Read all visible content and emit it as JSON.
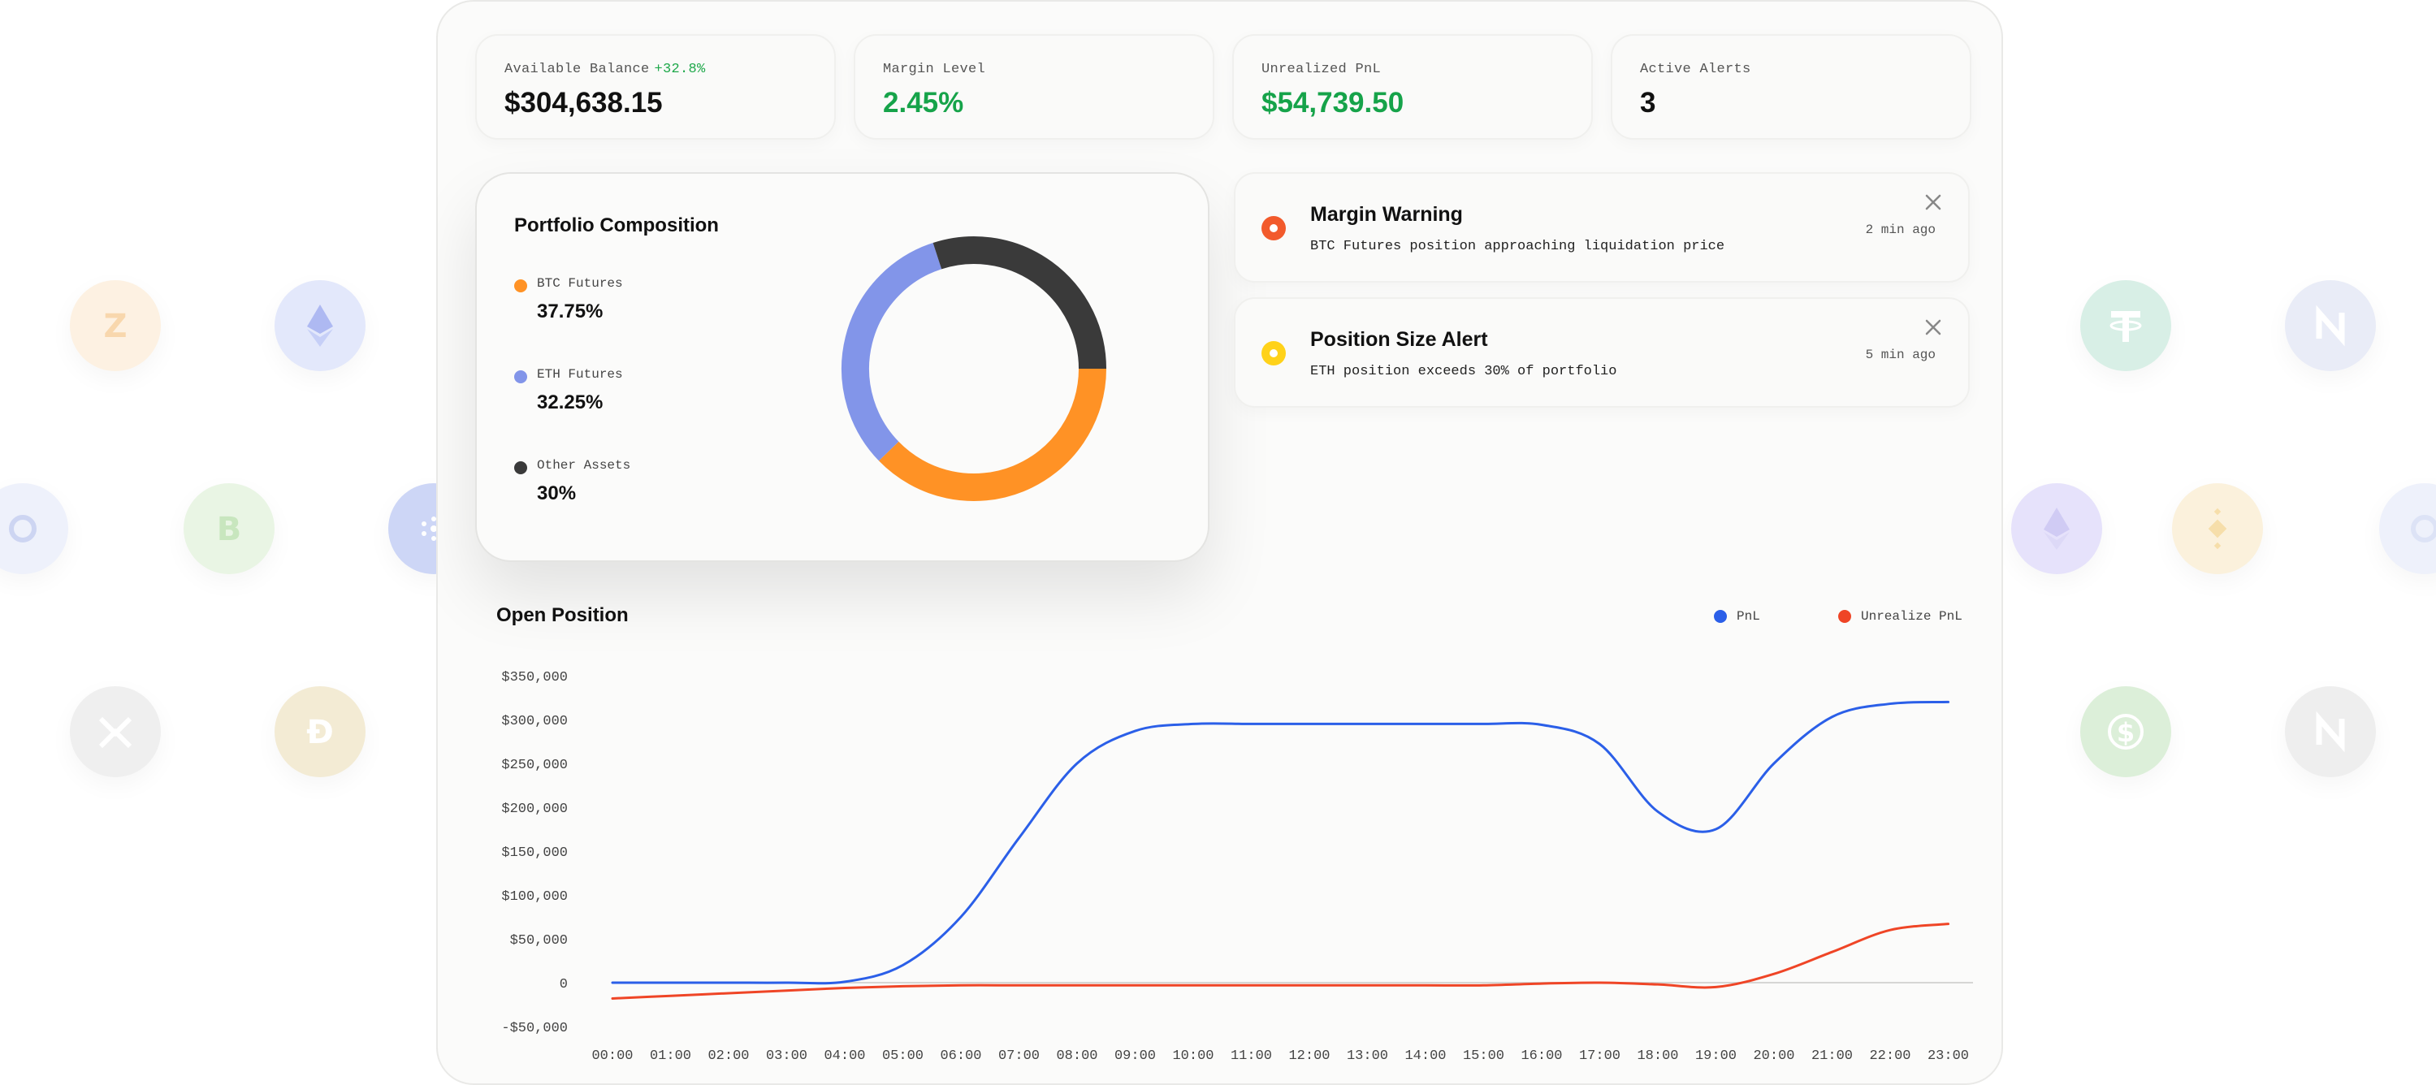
{
  "stats": [
    {
      "label": "Available Balance",
      "delta": "+32.8%",
      "value": "$304,638.15",
      "value_color": "#111111"
    },
    {
      "label": "Margin Level",
      "delta": "",
      "value": "2.45%",
      "value_color": "#16a34a"
    },
    {
      "label": "Unrealized PnL",
      "delta": "",
      "value": "$54,739.50",
      "value_color": "#16a34a"
    },
    {
      "label": "Active Alerts",
      "delta": "",
      "value": "3",
      "value_color": "#111111"
    }
  ],
  "composition": {
    "title": "Portfolio Composition",
    "items": [
      {
        "name": "BTC Futures",
        "value": "37.75%",
        "color": "#ff9225"
      },
      {
        "name": "ETH Futures",
        "value": "32.25%",
        "color": "#8295e9"
      },
      {
        "name": "Other Assets",
        "value": "30%",
        "color": "#3a3a3a"
      }
    ]
  },
  "alerts": [
    {
      "title": "Margin Warning",
      "description": "BTC Futures position approaching liquidation price",
      "time": "2 min ago",
      "color": "#f25a2c"
    },
    {
      "title": "Position Size Alert",
      "description": "ETH position exceeds 30% of portfolio",
      "time": "5 min ago",
      "color": "#ffd21a"
    }
  ],
  "chart_data": {
    "type": "line",
    "title": "Open Position",
    "x": [
      "00:00",
      "01:00",
      "02:00",
      "03:00",
      "04:00",
      "05:00",
      "06:00",
      "07:00",
      "08:00",
      "09:00",
      "10:00",
      "11:00",
      "12:00",
      "13:00",
      "14:00",
      "15:00",
      "16:00",
      "17:00",
      "18:00",
      "19:00",
      "20:00",
      "21:00",
      "22:00",
      "23:00"
    ],
    "yticks": [
      "$350,000",
      "$300,000",
      "$250,000",
      "$200,000",
      "$150,000",
      "$100,000",
      "$50,000",
      "0",
      "-$50,000"
    ],
    "ylim": [
      -50000,
      350000
    ],
    "series": [
      {
        "name": "PnL",
        "color": "#2b5fe8",
        "values": [
          0,
          0,
          0,
          0,
          1000,
          20000,
          75000,
          165000,
          250000,
          287000,
          295000,
          295000,
          295000,
          295000,
          295000,
          295000,
          294000,
          272000,
          195000,
          175000,
          250000,
          303000,
          318000,
          320000
        ]
      },
      {
        "name": "Unrealize PnL",
        "color": "#ef4526",
        "values": [
          -18000,
          -15000,
          -12000,
          -9000,
          -6000,
          -4000,
          -3000,
          -3000,
          -3000,
          -3000,
          -3000,
          -3000,
          -3000,
          -3000,
          -3000,
          -3000,
          -1000,
          0,
          -2000,
          -5000,
          10000,
          35000,
          60000,
          67000
        ]
      }
    ],
    "legend_position": "top-right",
    "grid": false
  }
}
